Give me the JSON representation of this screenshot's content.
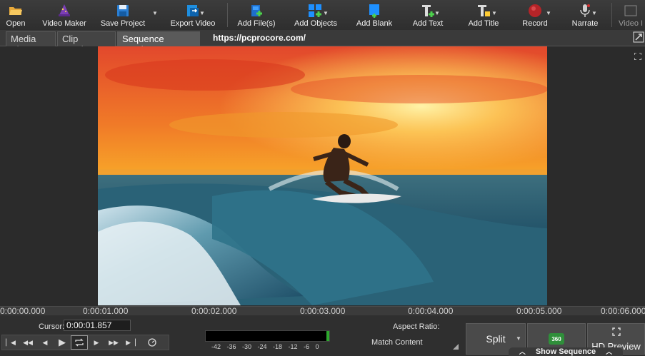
{
  "toolbar": {
    "open": "Open",
    "video_maker": "Video Maker",
    "save_project": "Save Project",
    "export_video": "Export Video",
    "add_files": "Add File(s)",
    "add_objects": "Add Objects",
    "add_blank": "Add Blank",
    "add_text": "Add Text",
    "add_title": "Add Title",
    "record": "Record",
    "narrate": "Narrate",
    "video_partial": "Video I"
  },
  "tabs": {
    "media_bin": "Media Bin",
    "clip_preview": "Clip Preview",
    "sequence_preview": "Sequence Preview"
  },
  "url_overlay": "https://pcprocore.com/",
  "timeline": {
    "ruler": [
      "0:00:00.000",
      "0:00:01.000",
      "0:00:02.000",
      "0:00:03.000",
      "0:00:04.000",
      "0:00:05.000",
      "0:00:06.000"
    ]
  },
  "bottom": {
    "cursor_label": "Cursor:",
    "cursor_value": "0:00:01.857",
    "meter_scale": "-42 -36 -30 -24 -18 -12 -6 0",
    "aspect_label": "Aspect Ratio:",
    "aspect_value": "Match Content",
    "split": "Split",
    "badge_360": "360",
    "hd_preview": "HD Preview",
    "show_sequence": "Show Sequence"
  },
  "colors": {
    "toolbar_bg": "#333333",
    "accent_blue": "#1e90ff",
    "record_red": "#c0282d"
  }
}
